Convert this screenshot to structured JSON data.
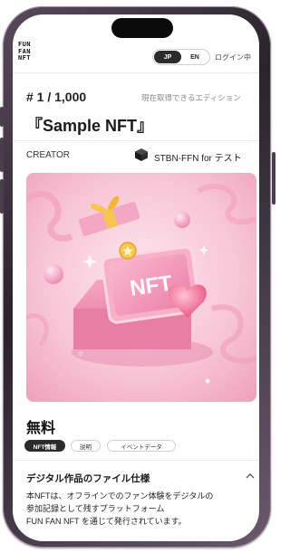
{
  "header": {
    "logo_lines": [
      "FUN",
      "FAN",
      "NFT"
    ],
    "lang_options": [
      "JP",
      "EN"
    ],
    "login_label": "ログイン中"
  },
  "nft": {
    "edition": "# 1 / 1,000",
    "edition_note": "現在取得できるエディション",
    "title": "『Sample NFT』",
    "creator_label": "CREATOR",
    "creator_name": "STBN-FFN for テスト",
    "artwork_text": "NFT",
    "price": "無料"
  },
  "tabs": [
    "NFT情報",
    "説明",
    "イベントデータ"
  ],
  "section": {
    "title": "デジタル作品のファイル仕様",
    "body_lines": [
      "本NFTは、オフラインでのファン体験をデジタルの",
      "参加記録として残すプラットフォーム",
      "FUN FAN NFT を通じて発行されています。"
    ]
  },
  "colors": {
    "frame": "#3b2f3d",
    "accent_dark": "#2b2b2b",
    "art_bg": "#f7c6d6",
    "art_pink": "#ef8fb0"
  },
  "icons": {
    "creator": "cube-icon",
    "chevron": "chevron-up-icon"
  }
}
